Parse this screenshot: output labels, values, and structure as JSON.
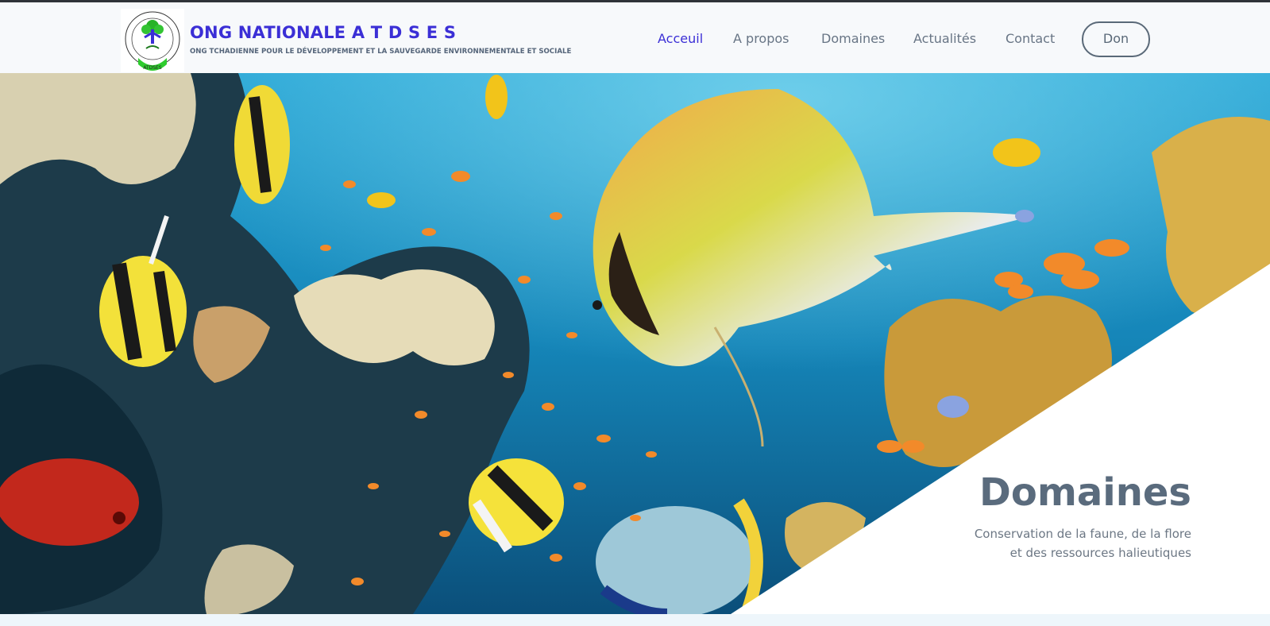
{
  "brand": {
    "title": "ONG NATIONALE A T D S E S",
    "subtitle": "ONG TCHADIENNE POUR LE DÉVELOPPEMENT ET LA SAUVEGARDE ENVIRONNEMENTALE ET SOCIALE",
    "logo_text": "ATDSES"
  },
  "nav": {
    "items": [
      {
        "label": "Acceuil",
        "active": true
      },
      {
        "label": "A propos",
        "active": false
      },
      {
        "label": "Domaines",
        "active": false
      },
      {
        "label": "Actualités",
        "active": false
      },
      {
        "label": "Contact",
        "active": false
      }
    ],
    "donate_label": "Don"
  },
  "hero": {
    "title": "Domaines",
    "description_line1": "Conservation de la faune, de la flore",
    "description_line2": "et des ressources halieutiques"
  },
  "colors": {
    "accent": "#3b2fd6",
    "text_muted": "#687585",
    "heading": "#5a6b7d",
    "water": "#1f8fbf"
  }
}
